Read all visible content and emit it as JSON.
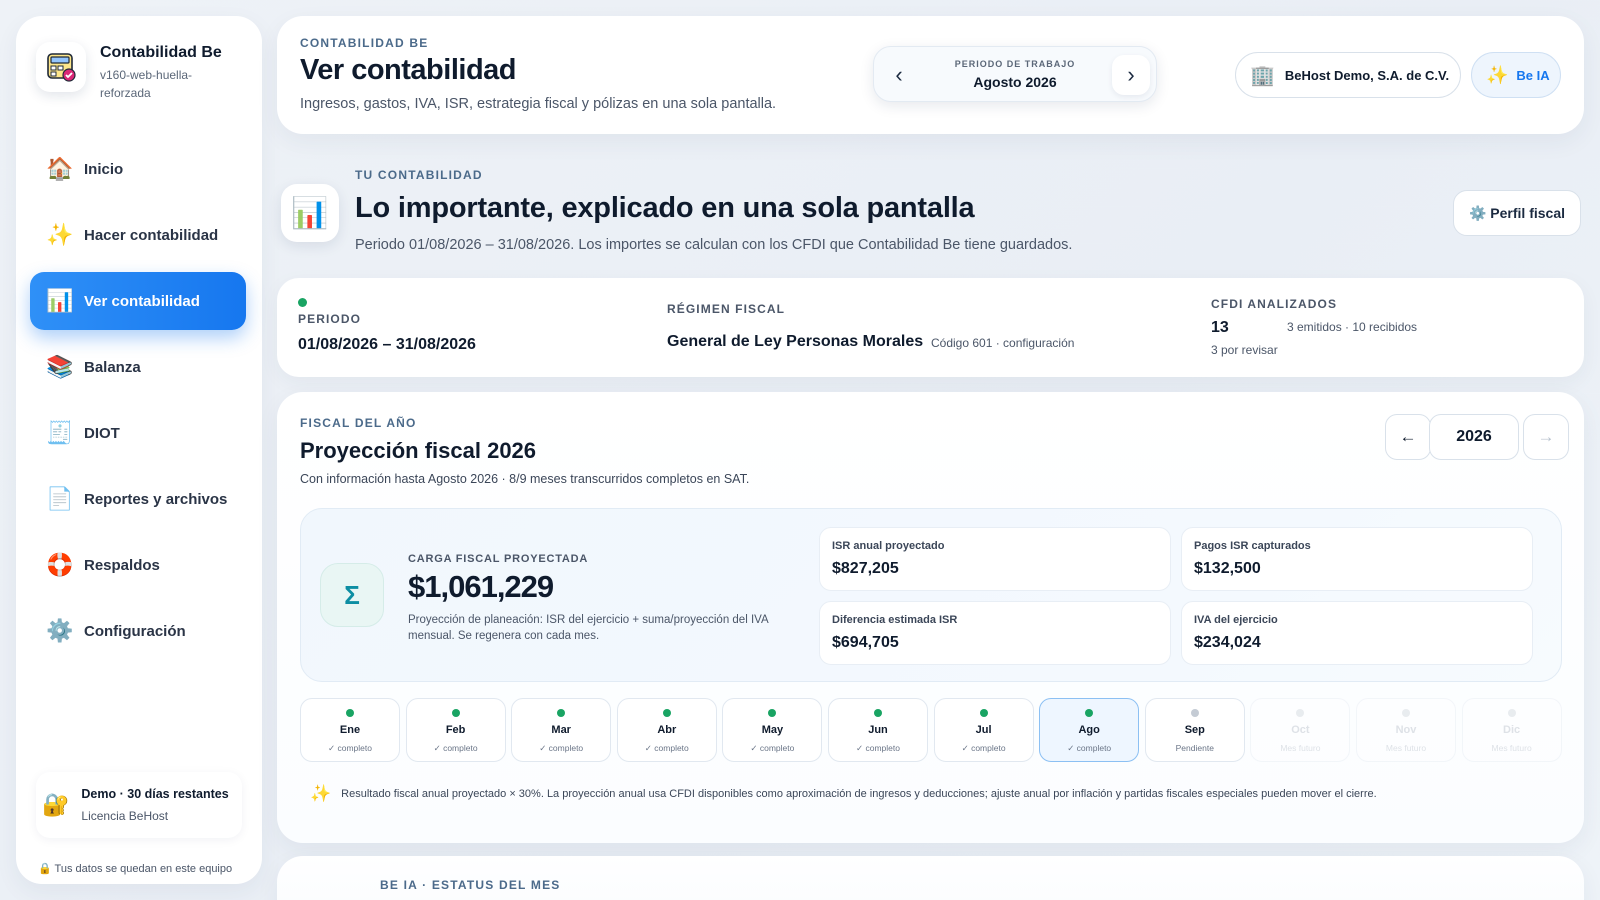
{
  "sidebar": {
    "brand_title": "Contabilidad Be",
    "brand_sub": "v160-web-huella-reforzada",
    "items": [
      {
        "label": "Inicio",
        "icon": "house-icon"
      },
      {
        "label": "Hacer contabilidad",
        "icon": "sparkles-icon"
      },
      {
        "label": "Ver contabilidad",
        "icon": "chart-icon"
      },
      {
        "label": "Balanza",
        "icon": "books-icon"
      },
      {
        "label": "DIOT",
        "icon": "receipt-icon"
      },
      {
        "label": "Reportes y archivos",
        "icon": "document-icon"
      },
      {
        "label": "Respaldos",
        "icon": "lifebuoy-icon"
      },
      {
        "label": "Configuración",
        "icon": "gear-icon"
      }
    ],
    "active_index": 2,
    "license_title": "Demo · 30 días restantes",
    "license_sub": "Licencia BeHost",
    "local_note": "🔒 Tus datos se quedan en este equipo"
  },
  "header": {
    "kicker": "CONTABILIDAD BE",
    "title": "Ver contabilidad",
    "subtitle": "Ingresos, gastos, IVA, ISR, estrategia fiscal y pólizas en una sola pantalla.",
    "period_label": "PERIODO DE TRABAJO",
    "period_value": "Agosto 2026",
    "company": "BeHost Demo, S.A. de C.V.",
    "beia_label": "Be IA"
  },
  "hero": {
    "kicker": "TU CONTABILIDAD",
    "title": "Lo importante, explicado en una sola pantalla",
    "subtitle": "Periodo 01/08/2026 – 31/08/2026. Los importes se calculan con los CFDI que Contabilidad Be tiene guardados.",
    "perfil_label": "⚙️ Perfil fiscal"
  },
  "info": {
    "periodo_label": "PERIODO",
    "periodo_value": "01/08/2026 – 31/08/2026",
    "regimen_label": "RÉGIMEN FISCAL",
    "regimen_value": "General de Ley Personas Morales",
    "regimen_code": "Código 601 · configuración",
    "cfdi_label": "CFDI ANALIZADOS",
    "cfdi_count": "13",
    "cfdi_breakdown": "3 emitidos · 10 recibidos",
    "cfdi_review": "3 por revisar"
  },
  "fiscal": {
    "kicker": "FISCAL DEL AÑO",
    "title": "Proyección fiscal 2026",
    "subtitle": "Con información hasta Agosto 2026 · 8/9 meses transcurridos completos en SAT.",
    "year": "2026",
    "prev_label": "←",
    "next_label": "→",
    "carga_label": "CARGA FISCAL PROYECTADA",
    "carga_value": "$1,061,229",
    "carga_note": "Proyección de planeación: ISR del ejercicio + suma/proyección del IVA mensual. Se regenera con cada mes.",
    "metrics": [
      {
        "label": "ISR anual proyectado",
        "value": "$827,205"
      },
      {
        "label": "Pagos ISR capturados",
        "value": "$132,500"
      },
      {
        "label": "Diferencia estimada ISR",
        "value": "$694,705"
      },
      {
        "label": "IVA del ejercicio",
        "value": "$234,024"
      }
    ],
    "months": [
      {
        "name": "Ene",
        "status": "✓ completo",
        "state": "done"
      },
      {
        "name": "Feb",
        "status": "✓ completo",
        "state": "done"
      },
      {
        "name": "Mar",
        "status": "✓ completo",
        "state": "done"
      },
      {
        "name": "Abr",
        "status": "✓ completo",
        "state": "done"
      },
      {
        "name": "May",
        "status": "✓ completo",
        "state": "done"
      },
      {
        "name": "Jun",
        "status": "✓ completo",
        "state": "done"
      },
      {
        "name": "Jul",
        "status": "✓ completo",
        "state": "done"
      },
      {
        "name": "Ago",
        "status": "✓ completo",
        "state": "active"
      },
      {
        "name": "Sep",
        "status": "Pendiente",
        "state": "pending"
      },
      {
        "name": "Oct",
        "status": "Mes futuro",
        "state": "future"
      },
      {
        "name": "Nov",
        "status": "Mes futuro",
        "state": "future"
      },
      {
        "name": "Dic",
        "status": "Mes futuro",
        "state": "future"
      }
    ],
    "footnote": "Resultado fiscal anual proyectado × 30%. La proyección anual usa CFDI disponibles como aproximación de ingresos y deducciones; ajuste anual por inflación y partidas fiscales especiales pueden mover el cierre."
  },
  "status": {
    "kicker": "BE IA · ESTATUS DEL MES"
  },
  "colors": {
    "accent": "#1677ef",
    "success": "#19a463",
    "teal": "#0d8ea3"
  }
}
